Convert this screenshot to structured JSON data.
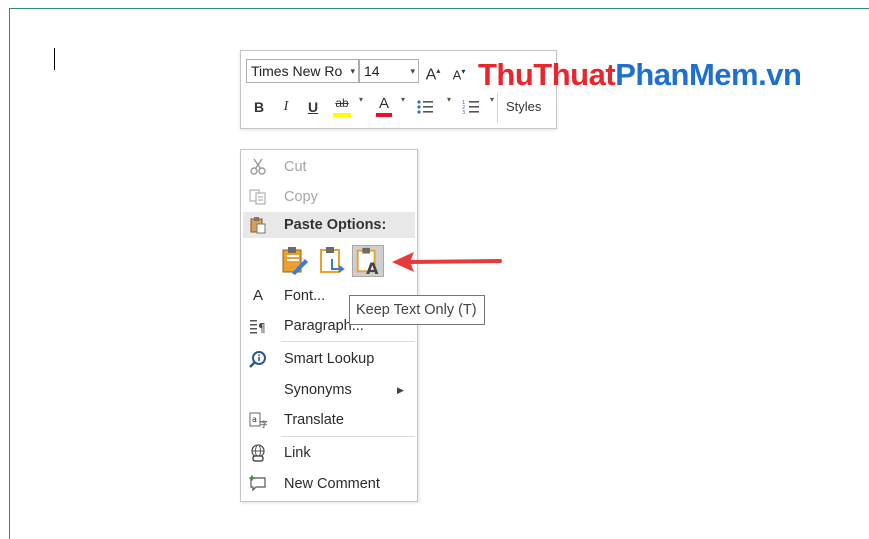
{
  "mini_toolbar": {
    "font_name": "Times New Ro",
    "font_size": "14",
    "grow_font": "A",
    "shrink_font": "A",
    "bold": "B",
    "italic": "I",
    "underline": "U",
    "highlight": "ab",
    "font_color": "A",
    "styles_label": "Styles"
  },
  "watermark": {
    "part1": "ThuThuat",
    "part2": "PhanMem",
    "part3": ".vn",
    "colors": {
      "red": "#e8262b",
      "blue": "#1f6fd1"
    }
  },
  "context_menu": {
    "cut": "Cut",
    "copy": "Copy",
    "paste_options": "Paste Options:",
    "font": "Font...",
    "paragraph": "Paragraph...",
    "smart_lookup": "Smart Lookup",
    "synonyms": "Synonyms",
    "translate": "Translate",
    "link": "Link",
    "new_comment": "New Comment"
  },
  "tooltip": {
    "text": "Keep Text Only (T)"
  }
}
